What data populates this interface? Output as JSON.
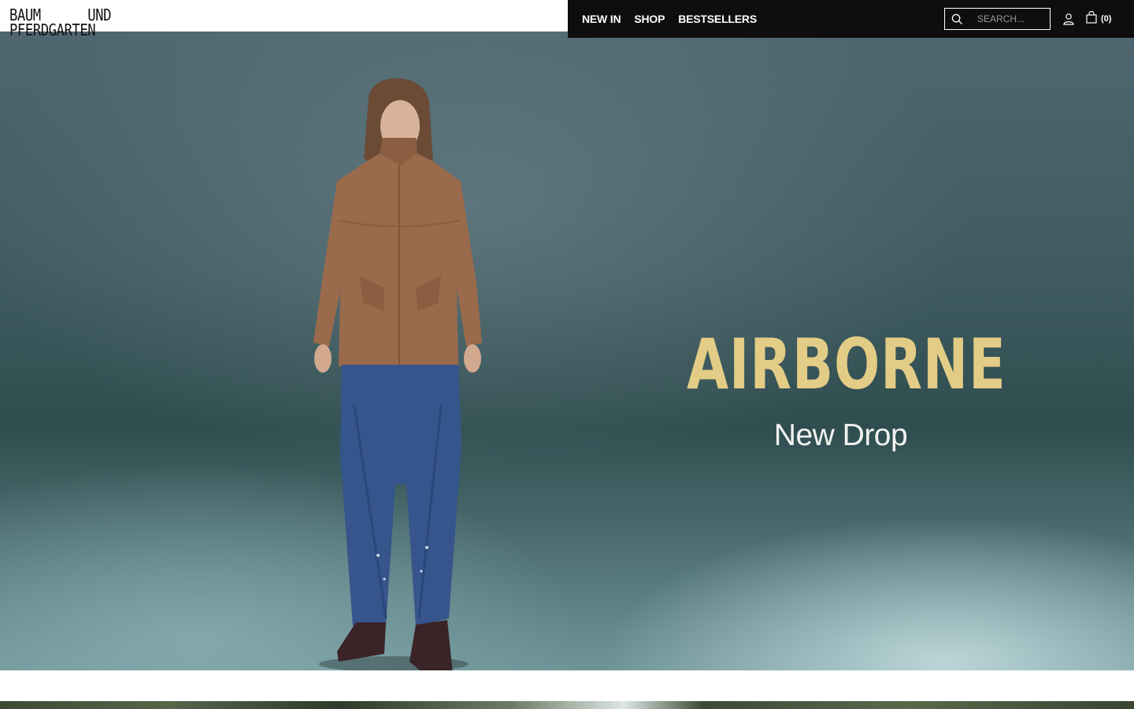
{
  "brand": {
    "logo_line1_left": "BAUM",
    "logo_line1_right": "UND",
    "logo_line2": "PFERDGARTEN"
  },
  "nav": {
    "items": [
      {
        "label": "NEW IN"
      },
      {
        "label": "SHOP"
      },
      {
        "label": "BESTSELLERS"
      }
    ]
  },
  "search": {
    "placeholder": "SEARCH..."
  },
  "cart": {
    "count_label": "(0)"
  },
  "hero": {
    "title": "AIRBORNE",
    "subtitle": "New Drop"
  },
  "colors": {
    "nav_background": "#0e0e0e",
    "hero_title": "#e3cc86",
    "hero_subtitle": "#f2f2f0"
  },
  "icons": {
    "search": "search-icon",
    "account": "account-icon",
    "cart": "shopping-bag-icon"
  }
}
